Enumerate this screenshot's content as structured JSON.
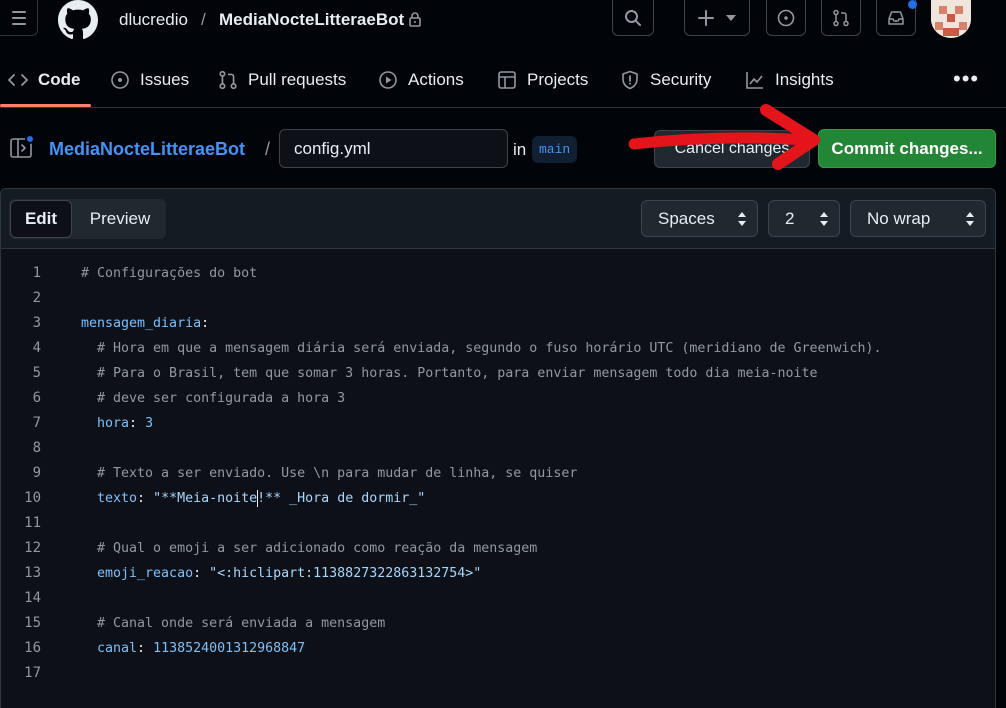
{
  "header": {
    "owner": "dlucredio",
    "separator": "/",
    "repo": "MediaNocteLitteraeBot"
  },
  "repo_nav": {
    "items": [
      {
        "label": "Code",
        "icon": "code-icon",
        "active": true
      },
      {
        "label": "Issues",
        "icon": "issue-icon"
      },
      {
        "label": "Pull requests",
        "icon": "pull-request-icon"
      },
      {
        "label": "Actions",
        "icon": "play-icon"
      },
      {
        "label": "Projects",
        "icon": "table-icon"
      },
      {
        "label": "Security",
        "icon": "shield-icon"
      },
      {
        "label": "Insights",
        "icon": "graph-icon"
      }
    ],
    "more": "•••"
  },
  "file_bar": {
    "repo_link": "MediaNocteLitteraeBot",
    "separator": "/",
    "filename": "config.yml",
    "in_label": "in",
    "branch": "main",
    "cancel_label": "Cancel changes",
    "commit_label": "Commit changes..."
  },
  "editor": {
    "tab_edit": "Edit",
    "tab_preview": "Preview",
    "indent_mode": "Spaces",
    "indent_size": "2",
    "wrap_mode": "No wrap",
    "lines": [
      {
        "n": "1",
        "segments": [
          {
            "t": "# Configurações do bot",
            "c": "comment"
          }
        ]
      },
      {
        "n": "2",
        "segments": []
      },
      {
        "n": "3",
        "segments": [
          {
            "t": "mensagem_diaria",
            "c": "key"
          },
          {
            "t": ":",
            "c": "plain"
          }
        ]
      },
      {
        "n": "4",
        "segments": [
          {
            "t": "  # Hora em que a mensagem diária será enviada, segundo o fuso horário UTC (meridiano de Greenwich).",
            "c": "comment"
          }
        ]
      },
      {
        "n": "5",
        "segments": [
          {
            "t": "  # Para o Brasil, tem que somar 3 horas. Portanto, para enviar mensagem todo dia meia-noite",
            "c": "comment"
          }
        ]
      },
      {
        "n": "6",
        "segments": [
          {
            "t": "  # deve ser configurada a hora 3",
            "c": "comment"
          }
        ]
      },
      {
        "n": "7",
        "segments": [
          {
            "t": "  hora",
            "c": "key"
          },
          {
            "t": ": ",
            "c": "plain"
          },
          {
            "t": "3",
            "c": "num"
          }
        ]
      },
      {
        "n": "8",
        "segments": []
      },
      {
        "n": "9",
        "segments": [
          {
            "t": "  # Texto a ser enviado. Use \\n para mudar de linha, se quiser",
            "c": "comment"
          }
        ]
      },
      {
        "n": "10",
        "segments": [
          {
            "t": "  texto",
            "c": "key"
          },
          {
            "t": ": ",
            "c": "plain"
          },
          {
            "t": "\"**Meia-noite",
            "c": "str"
          },
          {
            "t": "",
            "c": "caret"
          },
          {
            "t": "!** _Hora de dormir_\"",
            "c": "str"
          }
        ]
      },
      {
        "n": "11",
        "segments": []
      },
      {
        "n": "12",
        "segments": [
          {
            "t": "  # Qual o emoji a ser adicionado como reação da mensagem",
            "c": "comment"
          }
        ]
      },
      {
        "n": "13",
        "segments": [
          {
            "t": "  emoji_reacao",
            "c": "key"
          },
          {
            "t": ": ",
            "c": "plain"
          },
          {
            "t": "\"<:hiclipart:1138827322863132754>\"",
            "c": "str"
          }
        ]
      },
      {
        "n": "14",
        "segments": []
      },
      {
        "n": "15",
        "segments": [
          {
            "t": "  # Canal onde será enviada a mensagem",
            "c": "comment"
          }
        ]
      },
      {
        "n": "16",
        "segments": [
          {
            "t": "  canal",
            "c": "key"
          },
          {
            "t": ": ",
            "c": "plain"
          },
          {
            "t": "1138524001312968847",
            "c": "num"
          }
        ]
      },
      {
        "n": "17",
        "segments": []
      }
    ]
  },
  "colors": {
    "accent_blue": "#4493f8",
    "commit_green": "#238636",
    "annotation_red": "#e3151b",
    "nav_underline": "#f78166"
  }
}
